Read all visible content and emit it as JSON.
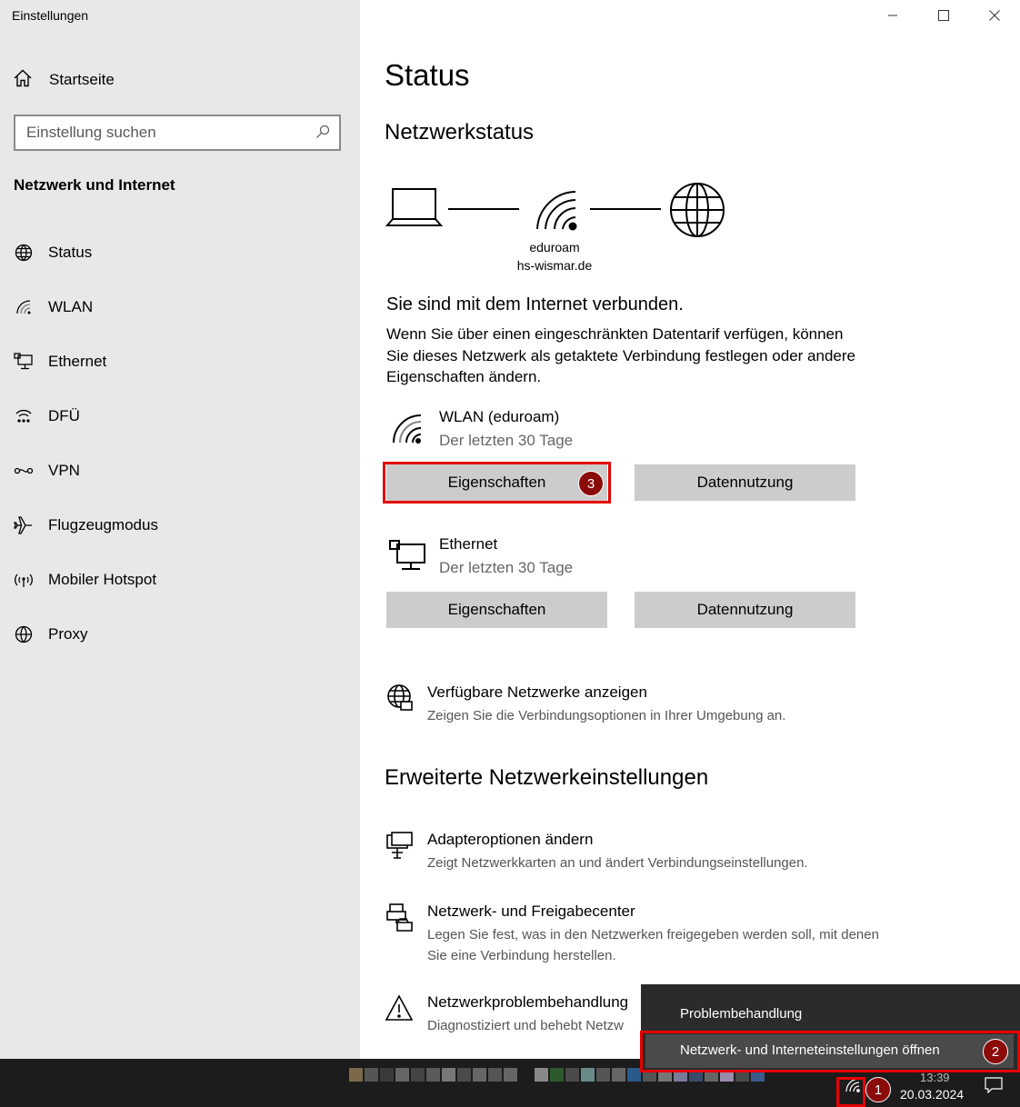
{
  "app_title": "Einstellungen",
  "sidebar": {
    "home_label": "Startseite",
    "search_placeholder": "Einstellung suchen",
    "section_title": "Netzwerk und Internet",
    "items": [
      {
        "label": "Status",
        "icon": "status-icon"
      },
      {
        "label": "WLAN",
        "icon": "wifi-icon"
      },
      {
        "label": "Ethernet",
        "icon": "ethernet-icon"
      },
      {
        "label": "DFÜ",
        "icon": "dialup-icon"
      },
      {
        "label": "VPN",
        "icon": "vpn-icon"
      },
      {
        "label": "Flugzeugmodus",
        "icon": "airplane-icon"
      },
      {
        "label": "Mobiler Hotspot",
        "icon": "hotspot-icon"
      },
      {
        "label": "Proxy",
        "icon": "proxy-icon"
      }
    ]
  },
  "main": {
    "title": "Status",
    "network_status_heading": "Netzwerkstatus",
    "network_name": "eduroam",
    "network_domain": "hs-wismar.de",
    "connected_text": "Sie sind mit dem Internet verbunden.",
    "description": "Wenn Sie über einen eingeschränkten Datentarif verfügen, können Sie dieses Netzwerk als getaktete Verbindung festlegen oder andere Eigenschaften ändern.",
    "connections": [
      {
        "name": "WLAN (eduroam)",
        "subtitle": "Der letzten 30 Tage",
        "properties_label": "Eigenschaften",
        "data_usage_label": "Datennutzung"
      },
      {
        "name": "Ethernet",
        "subtitle": "Der letzten 30 Tage",
        "properties_label": "Eigenschaften",
        "data_usage_label": "Datennutzung"
      }
    ],
    "available_networks": {
      "title": "Verfügbare Netzwerke anzeigen",
      "desc": "Zeigen Sie die Verbindungsoptionen in Ihrer Umgebung an."
    },
    "advanced_heading": "Erweiterte Netzwerkeinstellungen",
    "advanced_items": [
      {
        "title": "Adapteroptionen ändern",
        "desc": "Zeigt Netzwerkkarten an und ändert Verbindungseinstellungen."
      },
      {
        "title": "Netzwerk- und Freigabecenter",
        "desc": "Legen Sie fest, was in den Netzwerken freigegeben werden soll, mit denen Sie eine Verbindung herstellen."
      },
      {
        "title": "Netzwerkproblembehandlung",
        "desc": "Diagnostiziert und behebt Netzw"
      }
    ]
  },
  "context_menu": {
    "items": [
      "Problembehandlung",
      "Netzwerk- und Interneteinstellungen öffnen"
    ]
  },
  "taskbar": {
    "date": "20.03.2024",
    "time": "13:39"
  },
  "annotations": {
    "step1": "1",
    "step2": "2",
    "step3": "3",
    "color": "#e60000"
  }
}
